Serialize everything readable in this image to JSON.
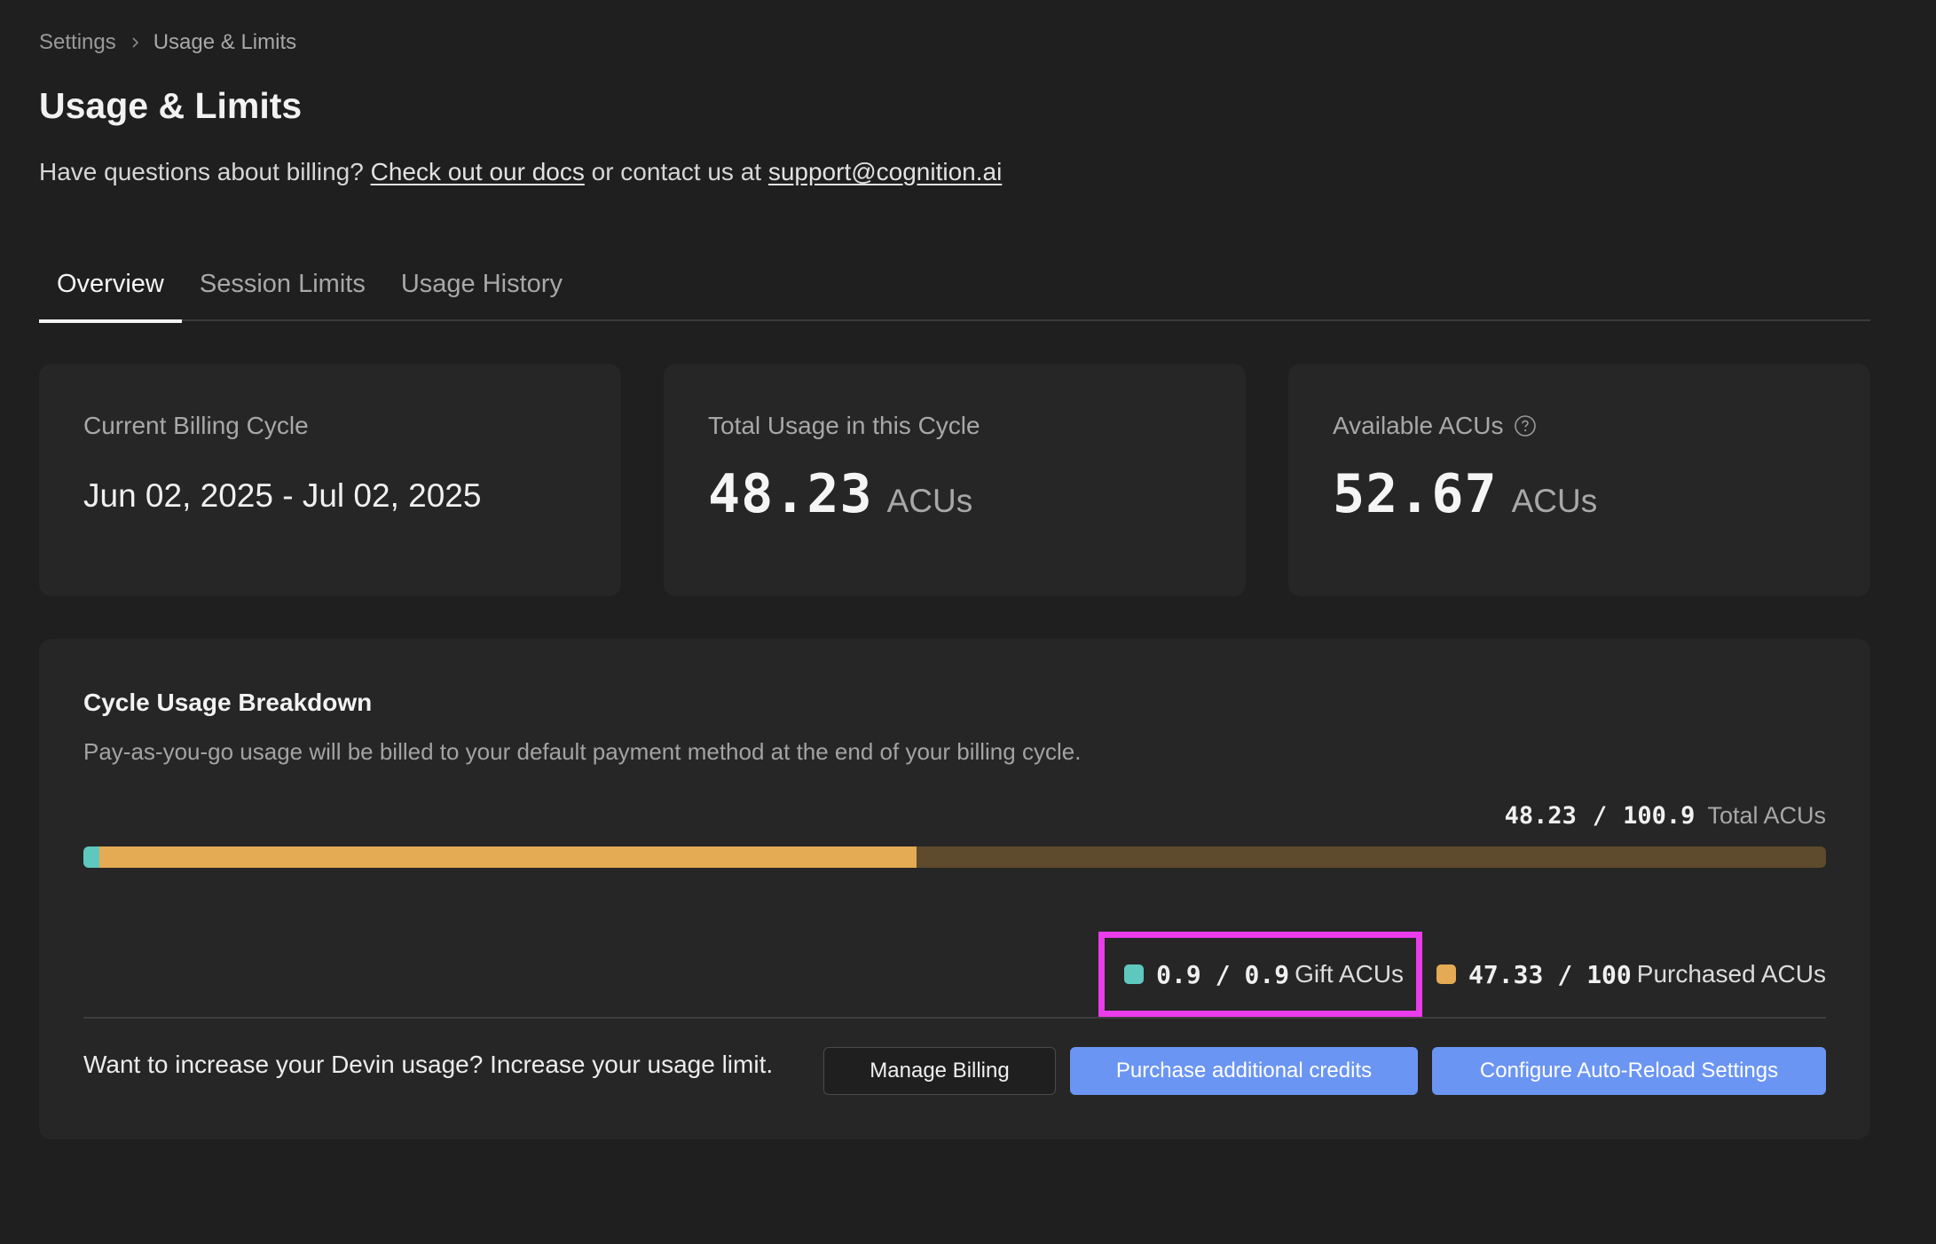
{
  "breadcrumb": {
    "parent": "Settings",
    "current": "Usage & Limits"
  },
  "page_title": "Usage & Limits",
  "subtitle": {
    "prefix": "Have questions about billing? ",
    "docs_link": "Check out our docs",
    "middle": " or contact us at ",
    "email_link": "support@cognition.ai"
  },
  "tabs": [
    {
      "label": "Overview",
      "active": true
    },
    {
      "label": "Session Limits",
      "active": false
    },
    {
      "label": "Usage History",
      "active": false
    }
  ],
  "cards": {
    "billing_cycle": {
      "label": "Current Billing Cycle",
      "value": "Jun 02, 2025 - Jul 02, 2025"
    },
    "total_usage": {
      "label": "Total Usage in this Cycle",
      "value": "48.23",
      "unit": "ACUs"
    },
    "available": {
      "label": "Available ACUs",
      "value": "52.67",
      "unit": "ACUs",
      "icon": "help-circle-icon"
    }
  },
  "breakdown": {
    "title": "Cycle Usage Breakdown",
    "description": "Pay-as-you-go usage will be billed to your default payment method at the end of your billing cycle.",
    "total_used": "48.23",
    "total_sep": "/",
    "total_limit": "100.9",
    "total_label": "Total ACUs",
    "bar": {
      "total": 100.9,
      "gift_used": 0.9,
      "purchased_used": 47.33
    },
    "legend": {
      "gift": {
        "used": "0.9",
        "sep": "/",
        "limit": "0.9",
        "label": "Gift ACUs",
        "color": "#5ec8bf"
      },
      "purchased": {
        "used": "47.33",
        "sep": "/",
        "limit": "100",
        "label": "Purchased ACUs",
        "color": "#e5aa54"
      }
    },
    "footer_text": "Want to increase your Devin usage? Increase your usage limit.",
    "buttons": {
      "manage_billing": "Manage Billing",
      "purchase_credits": "Purchase additional credits",
      "auto_reload": "Configure Auto-Reload Settings"
    }
  },
  "colors": {
    "background": "#1f1f1f",
    "card": "#262626",
    "accent_blue": "#6b95f2",
    "highlight": "#ea3cea",
    "bar_track": "#5e4a2c"
  }
}
